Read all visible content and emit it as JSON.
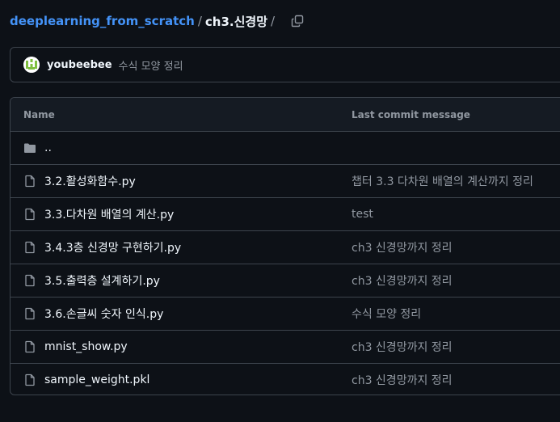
{
  "breadcrumb": {
    "repo": "deeplearning_from_scratch",
    "separator": "/",
    "current": "ch3.신경망",
    "trailing_separator": "/"
  },
  "latest_commit": {
    "author": "youbeebee",
    "message": "수식 모양 정리"
  },
  "table": {
    "header_name": "Name",
    "header_message": "Last commit message",
    "parent_row": "..",
    "rows": [
      {
        "name": "3.2.활성화함수.py",
        "message": "챕터 3.3 다차원 배열의 계산까지 정리",
        "icon": "file-icon"
      },
      {
        "name": "3.3.다차원 배열의 계산.py",
        "message": "test",
        "icon": "file-icon"
      },
      {
        "name": "3.4.3층 신경망 구현하기.py",
        "message": "ch3 신경망까지 정리",
        "icon": "file-icon"
      },
      {
        "name": "3.5.출력층 설계하기.py",
        "message": "ch3 신경망까지 정리",
        "icon": "file-icon"
      },
      {
        "name": "3.6.손글씨 숫자 인식.py",
        "message": "수식 모양 정리",
        "icon": "file-icon"
      },
      {
        "name": "mnist_show.py",
        "message": "ch3 신경망까지 정리",
        "icon": "file-icon"
      },
      {
        "name": "sample_weight.pkl",
        "message": "ch3 신경망까지 정리",
        "icon": "file-icon"
      }
    ]
  },
  "colors": {
    "background": "#0d1117",
    "link": "#4493f8",
    "border": "#3d444d",
    "muted": "#9198a1",
    "avatar_accent": "#7fbf3f"
  }
}
